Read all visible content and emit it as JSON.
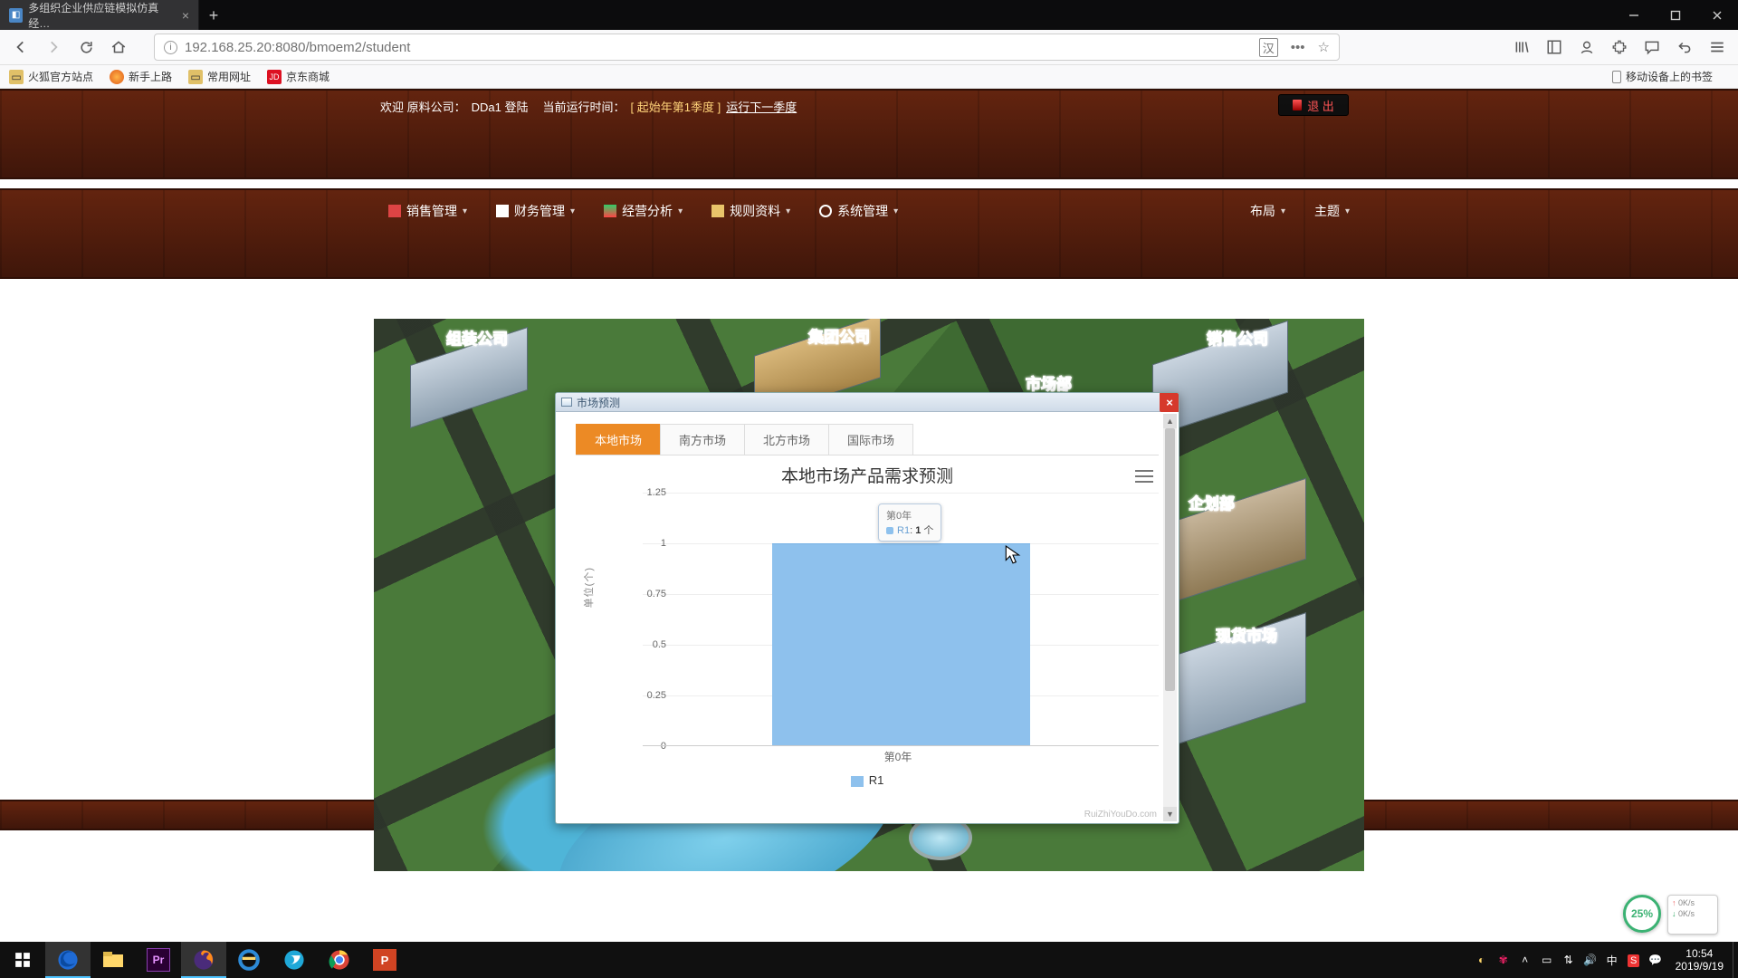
{
  "browser": {
    "tab_title": "多组织企业供应链模拟仿真经…",
    "url": "192.168.25.20:8080/bmoem2/student",
    "bookmarks": [
      "火狐官方站点",
      "新手上路",
      "常用网址",
      "京东商城"
    ],
    "devices_bookmark": "移动设备上的书签"
  },
  "status": {
    "welcome": "欢迎 原料公司：",
    "user": "DDa1 登陆",
    "runtime_label": "当前运行时间：",
    "runtime_value": "[ 起始年第1季度 ]",
    "next_link": "运行下一季度",
    "exit": "退 出"
  },
  "menu": {
    "items": [
      "销售管理",
      "财务管理",
      "经营分析",
      "规则资料",
      "系统管理"
    ],
    "right": [
      "布局",
      "主题"
    ]
  },
  "scene_labels": {
    "assembly": "组装公司",
    "group": "集团公司",
    "sales": "销售公司",
    "marketdept": "市场部",
    "plandept": "企划部",
    "spotmarket": "现货市场"
  },
  "modal": {
    "title": "市场预测",
    "tabs": [
      "本地市场",
      "南方市场",
      "北方市场",
      "国际市场"
    ],
    "active_tab": 0,
    "credit": "RuiZhiYouDo.com"
  },
  "chart_data": {
    "type": "bar",
    "title": "本地市场产品需求预测",
    "ylabel": "单位(个)",
    "categories": [
      "第0年"
    ],
    "series": [
      {
        "name": "R1",
        "values": [
          1
        ]
      }
    ],
    "yticks": [
      0,
      0.25,
      0.5,
      0.75,
      1,
      1.25
    ],
    "ylim": [
      0,
      1.25
    ],
    "tooltip": {
      "header": "第0年",
      "series": "R1",
      "value": "1",
      "unit": "个"
    }
  },
  "gauge": "25%",
  "net": {
    "up": "0K/s",
    "down": "0K/s"
  },
  "clock": {
    "time": "10:54",
    "date": "2019/9/19"
  }
}
